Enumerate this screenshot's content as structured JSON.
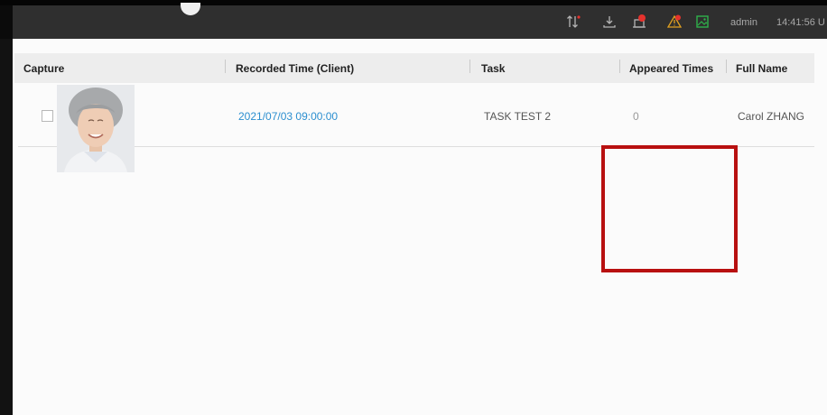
{
  "header": {
    "user": "admin",
    "clock": "14:41:56 U"
  },
  "table": {
    "columns": [
      "Capture",
      "Recorded Time (Client)",
      "Task",
      "Appeared Times",
      "Full Name"
    ],
    "rows": [
      {
        "recorded_time": "2021/07/03 09:00:00",
        "task": "TASK TEST 2",
        "appeared_times": "0",
        "full_name": "Carol ZHANG"
      }
    ]
  },
  "colors": {
    "topbar": "#2f2f2f",
    "link": "#2c8fd0",
    "highlight": "#b81010",
    "alert": "#e5322d",
    "ok": "#2fb24a"
  },
  "icons": [
    "transfer-icon",
    "download-icon",
    "alarm-device-icon",
    "warning-icon",
    "image-icon"
  ]
}
